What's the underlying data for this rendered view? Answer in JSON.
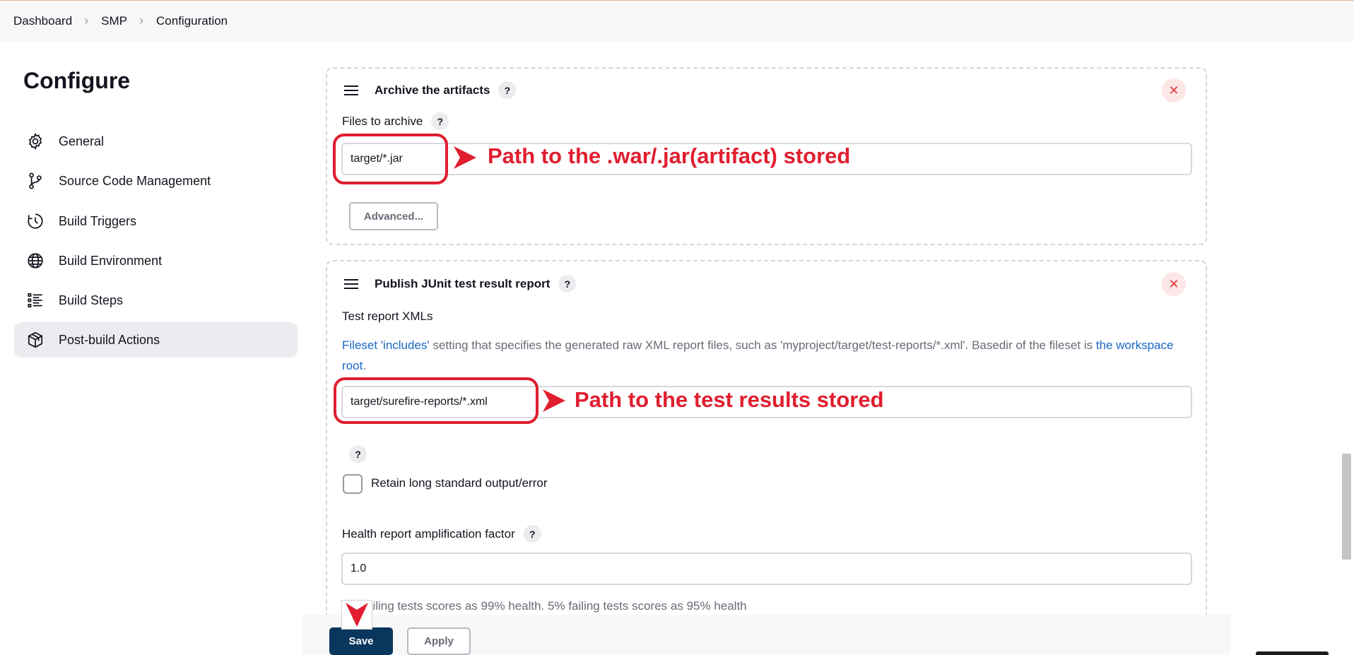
{
  "breadcrumb": [
    "Dashboard",
    "SMP",
    "Configuration"
  ],
  "sidebar": {
    "title": "Configure",
    "items": [
      {
        "label": "General",
        "icon": "gear-icon"
      },
      {
        "label": "Source Code Management",
        "icon": "branch-icon"
      },
      {
        "label": "Build Triggers",
        "icon": "clock-icon"
      },
      {
        "label": "Build Environment",
        "icon": "globe-icon"
      },
      {
        "label": "Build Steps",
        "icon": "list-icon"
      },
      {
        "label": "Post-build Actions",
        "icon": "package-icon",
        "active": true
      }
    ]
  },
  "archive": {
    "title": "Archive the artifacts",
    "files_label": "Files to archive",
    "files_value": "target/*.jar",
    "advanced_label": "Advanced..."
  },
  "junit": {
    "title": "Publish JUnit test result report",
    "xml_label": "Test report XMLs",
    "desc_link1": "Fileset 'includes'",
    "desc_mid": " setting that specifies the generated raw XML report files, such as 'myproject/target/test-reports/*.xml'. Basedir of the fileset is ",
    "desc_link2": "the workspace root",
    "desc_end": ".",
    "xml_value": "target/surefire-reports/*.xml",
    "retain_label": "Retain long standard output/error",
    "retain_checked": false,
    "health_label": "Health report amplification factor",
    "health_value": "1.0",
    "health_desc": "1% failing tests scores as 99% health. 5% failing tests scores as 95% health"
  },
  "annotations": {
    "artifact": "Path to the .war/.jar(artifact) stored",
    "tests": "Path to the test results stored"
  },
  "footer": {
    "save_label": "Save",
    "apply_label": "Apply"
  },
  "colors": {
    "annotation_red": "#e01e2f",
    "save_bg": "#08365d",
    "link_blue": "#1a67c4"
  }
}
